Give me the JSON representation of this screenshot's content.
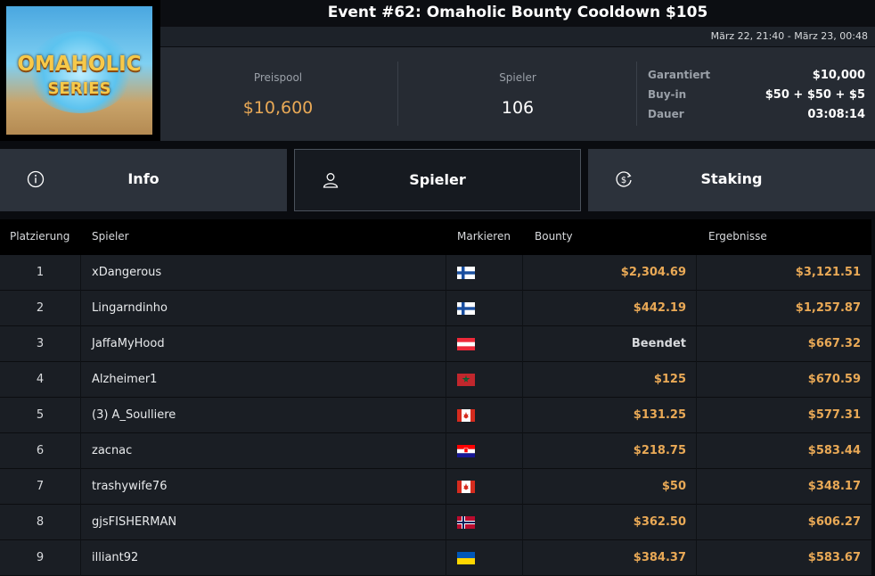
{
  "header": {
    "title": "Event #62: Omaholic Bounty Cooldown $105",
    "date_range": "März 22, 21:40 - März 23, 00:48"
  },
  "logo": {
    "line1": "OMAHOLIC",
    "line2": "SERIES"
  },
  "stats": {
    "prizepool_label": "Preispool",
    "prizepool_value": "$10,600",
    "players_label": "Spieler",
    "players_value": "106",
    "guaranteed_label": "Garantiert",
    "guaranteed_value": "$10,000",
    "buyin_label": "Buy-in",
    "buyin_value": "$50 + $50 + $5",
    "duration_label": "Dauer",
    "duration_value": "03:08:14"
  },
  "tabs": [
    {
      "label": "Info",
      "icon": "info-icon"
    },
    {
      "label": "Spieler",
      "icon": "user-icon",
      "active": true
    },
    {
      "label": "Staking",
      "icon": "dollar-cycle-icon"
    }
  ],
  "table": {
    "columns": {
      "rank": "Platzierung",
      "player": "Spieler",
      "flag": "Markieren",
      "bounty": "Bounty",
      "result": "Ergebnisse"
    },
    "rows": [
      {
        "rank": "1",
        "name": "xDangerous",
        "flag": "finland",
        "bounty": "$2,304.69",
        "result": "$3,121.51"
      },
      {
        "rank": "2",
        "name": "Lingarndinho",
        "flag": "finland",
        "bounty": "$442.19",
        "result": "$1,257.87"
      },
      {
        "rank": "3",
        "name": "JaffaMyHood",
        "flag": "austria",
        "bounty": "Beendet",
        "result": "$667.32"
      },
      {
        "rank": "4",
        "name": "Alzheimer1",
        "flag": "morocco",
        "bounty": "$125",
        "result": "$670.59"
      },
      {
        "rank": "5",
        "name": "(3) A_Soulliere",
        "flag": "canada",
        "bounty": "$131.25",
        "result": "$577.31"
      },
      {
        "rank": "6",
        "name": "zacnac",
        "flag": "croatia",
        "bounty": "$218.75",
        "result": "$583.44"
      },
      {
        "rank": "7",
        "name": "trashywife76",
        "flag": "canada",
        "bounty": "$50",
        "result": "$348.17"
      },
      {
        "rank": "8",
        "name": "gjsFISHERMAN",
        "flag": "norway",
        "bounty": "$362.50",
        "result": "$606.27"
      },
      {
        "rank": "9",
        "name": "illiant92",
        "flag": "ukraine",
        "bounty": "$384.37",
        "result": "$583.67"
      }
    ]
  },
  "colors": {
    "gold": "#e9a956",
    "row_bg": "#1a1e24",
    "tab_bg": "#2c323b",
    "stats_bg": "#262b33"
  }
}
